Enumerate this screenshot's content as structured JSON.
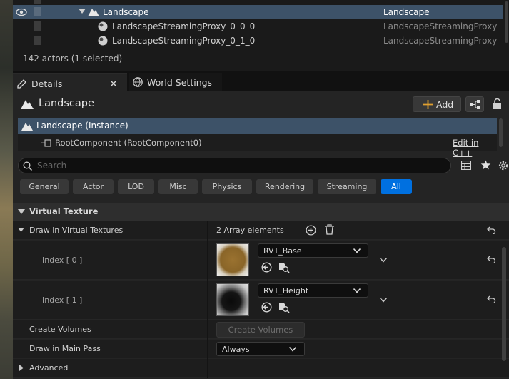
{
  "outliner": {
    "rows": [
      {
        "name": "Landscape",
        "type": "Landscape"
      },
      {
        "name": "LandscapeStreamingProxy_0_0_0",
        "type": "LandscapeStreamingProxy"
      },
      {
        "name": "LandscapeStreamingProxy_0_1_0",
        "type": "LandscapeStreamingProxy"
      }
    ],
    "status": "142 actors (1 selected)"
  },
  "tabs": {
    "details": "Details",
    "world_settings": "World Settings"
  },
  "details": {
    "title": "Landscape",
    "add_label": "Add",
    "tree": {
      "instance": "Landscape (Instance)",
      "root": "RootComponent (RootComponent0)",
      "edit_cpp": "Edit in C++"
    },
    "search_placeholder": "Search",
    "filters": [
      "General",
      "Actor",
      "LOD",
      "Misc",
      "Physics",
      "Rendering",
      "Streaming",
      "All"
    ],
    "active_filter": "All"
  },
  "virtual_texture": {
    "section_title": "Virtual Texture",
    "draw_in_vt_label": "Draw in Virtual Textures",
    "array_count": "2 Array elements",
    "elements": [
      {
        "index_label": "Index [ 0 ]",
        "asset": "RVT_Base"
      },
      {
        "index_label": "Index [ 1 ]",
        "asset": "RVT_Height"
      }
    ],
    "create_volumes_label": "Create Volumes",
    "create_volumes_button": "Create Volumes",
    "draw_main_pass_label": "Draw in Main Pass",
    "draw_main_pass_value": "Always",
    "advanced_label": "Advanced"
  },
  "colors": {
    "selection": "#3d5268",
    "accent": "#0070e0"
  }
}
